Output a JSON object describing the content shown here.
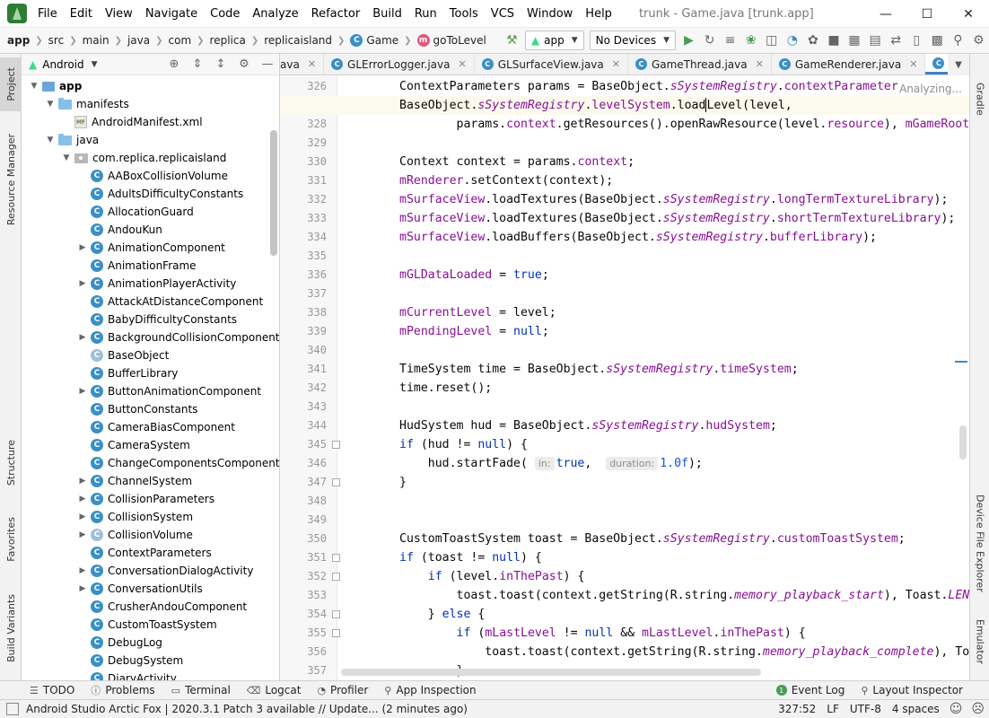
{
  "menubar": {
    "items": [
      "File",
      "Edit",
      "View",
      "Navigate",
      "Code",
      "Analyze",
      "Refactor",
      "Build",
      "Run",
      "Tools",
      "VCS",
      "Window",
      "Help"
    ],
    "window_title": "trunk - Game.java [trunk.app]"
  },
  "navbar": {
    "breadcrumbs": [
      "app",
      "src",
      "main",
      "java",
      "com",
      "replica",
      "replicaisland"
    ],
    "class_crumb": "Game",
    "method_crumb": "goToLevel",
    "run_config": "app",
    "device": "No Devices"
  },
  "left_tool_tabs": [
    "Project",
    "Resource Manager",
    "Structure",
    "Favorites",
    "Build Variants"
  ],
  "right_tool_tabs": [
    "Gradle",
    "Device File Explorer",
    "Emulator"
  ],
  "project_panel": {
    "view_mode": "Android",
    "tree": [
      {
        "label": "app",
        "type": "module",
        "depth": 0,
        "expanded": true,
        "bold": true
      },
      {
        "label": "manifests",
        "type": "folder",
        "depth": 1,
        "expanded": true
      },
      {
        "label": "AndroidManifest.xml",
        "type": "manifest",
        "depth": 2
      },
      {
        "label": "java",
        "type": "folder",
        "depth": 1,
        "expanded": true
      },
      {
        "label": "com.replica.replicaisland",
        "type": "package",
        "depth": 2,
        "expanded": true
      },
      {
        "label": "AABoxCollisionVolume",
        "type": "class",
        "depth": 3
      },
      {
        "label": "AdultsDifficultyConstants",
        "type": "class",
        "depth": 3
      },
      {
        "label": "AllocationGuard",
        "type": "class",
        "depth": 3
      },
      {
        "label": "AndouKun",
        "type": "class",
        "depth": 3
      },
      {
        "label": "AnimationComponent",
        "type": "class",
        "depth": 3,
        "expandable": true
      },
      {
        "label": "AnimationFrame",
        "type": "class",
        "depth": 3
      },
      {
        "label": "AnimationPlayerActivity",
        "type": "class",
        "depth": 3,
        "expandable": true
      },
      {
        "label": "AttackAtDistanceComponent",
        "type": "class",
        "depth": 3
      },
      {
        "label": "BabyDifficultyConstants",
        "type": "class",
        "depth": 3
      },
      {
        "label": "BackgroundCollisionComponent",
        "type": "class",
        "depth": 3,
        "expandable": true
      },
      {
        "label": "BaseObject",
        "type": "abstract",
        "depth": 3
      },
      {
        "label": "BufferLibrary",
        "type": "class",
        "depth": 3
      },
      {
        "label": "ButtonAnimationComponent",
        "type": "class",
        "depth": 3,
        "expandable": true
      },
      {
        "label": "ButtonConstants",
        "type": "class",
        "depth": 3
      },
      {
        "label": "CameraBiasComponent",
        "type": "class",
        "depth": 3
      },
      {
        "label": "CameraSystem",
        "type": "class",
        "depth": 3
      },
      {
        "label": "ChangeComponentsComponent",
        "type": "class",
        "depth": 3
      },
      {
        "label": "ChannelSystem",
        "type": "class",
        "depth": 3,
        "expandable": true
      },
      {
        "label": "CollisionParameters",
        "type": "class",
        "depth": 3,
        "expandable": true
      },
      {
        "label": "CollisionSystem",
        "type": "class",
        "depth": 3,
        "expandable": true
      },
      {
        "label": "CollisionVolume",
        "type": "abstract",
        "depth": 3,
        "expandable": true
      },
      {
        "label": "ContextParameters",
        "type": "class",
        "depth": 3
      },
      {
        "label": "ConversationDialogActivity",
        "type": "class",
        "depth": 3,
        "expandable": true
      },
      {
        "label": "ConversationUtils",
        "type": "class",
        "depth": 3,
        "expandable": true
      },
      {
        "label": "CrusherAndouComponent",
        "type": "class",
        "depth": 3
      },
      {
        "label": "CustomToastSystem",
        "type": "class",
        "depth": 3
      },
      {
        "label": "DebugLog",
        "type": "class",
        "depth": 3
      },
      {
        "label": "DebugSystem",
        "type": "class",
        "depth": 3
      },
      {
        "label": "DiaryActivity",
        "type": "class",
        "depth": 3
      }
    ]
  },
  "editor_tabs": [
    {
      "label": "ava",
      "partial": true
    },
    {
      "label": "GLErrorLogger.java"
    },
    {
      "label": "GLSurfaceView.java"
    },
    {
      "label": "GameThread.java"
    },
    {
      "label": "GameRenderer.java"
    },
    {
      "label": "Game.java",
      "active": true
    }
  ],
  "editor": {
    "analyzing_label": "Analyzing...",
    "current_line": "327",
    "lines": [
      {
        "n": "326",
        "html": "ContextParameters params = BaseObject.<span class='sf'>sSystemRegistry</span>.<span class='fld'>contextParameters</span>;"
      },
      {
        "n": "327",
        "html": "BaseObject.<span class='sf'>sSystemRegistry</span>.<span class='fld'>levelSystem</span>.load<span class='caret'></span>Level(level,"
      },
      {
        "n": "328",
        "html": "        params.<span class='fld'>context</span>.getResources().openRawResource(level.<span class='fld'>resource</span>), <span class='fld'>mGameRoot</span>);"
      },
      {
        "n": "329",
        "html": ""
      },
      {
        "n": "330",
        "html": "Context context = params.<span class='fld'>context</span>;"
      },
      {
        "n": "331",
        "html": "<span class='fld'>mRenderer</span>.setContext(context);"
      },
      {
        "n": "332",
        "html": "<span class='fld'>mSurfaceView</span>.loadTextures(BaseObject.<span class='sf'>sSystemRegistry</span>.<span class='fld'>longTermTextureLibrary</span>);"
      },
      {
        "n": "333",
        "html": "<span class='fld'>mSurfaceView</span>.loadTextures(BaseObject.<span class='sf'>sSystemRegistry</span>.<span class='fld'>shortTermTextureLibrary</span>);"
      },
      {
        "n": "334",
        "html": "<span class='fld'>mSurfaceView</span>.loadBuffers(BaseObject.<span class='sf'>sSystemRegistry</span>.<span class='fld'>bufferLibrary</span>);"
      },
      {
        "n": "335",
        "html": ""
      },
      {
        "n": "336",
        "html": "<span class='fld'>mGLDataLoaded</span> = <span class='kw'>true</span>;"
      },
      {
        "n": "337",
        "html": ""
      },
      {
        "n": "338",
        "html": "<span class='fld'>mCurrentLevel</span> = level;"
      },
      {
        "n": "339",
        "html": "<span class='fld'>mPendingLevel</span> = <span class='kw'>null</span>;"
      },
      {
        "n": "340",
        "html": ""
      },
      {
        "n": "341",
        "html": "TimeSystem time = BaseObject.<span class='sf'>sSystemRegistry</span>.<span class='fld'>timeSystem</span>;"
      },
      {
        "n": "342",
        "html": "time.reset();"
      },
      {
        "n": "343",
        "html": ""
      },
      {
        "n": "344",
        "html": "HudSystem hud = BaseObject.<span class='sf'>sSystemRegistry</span>.<span class='fld'>hudSystem</span>;"
      },
      {
        "n": "345",
        "html": "<span class='kw'>if</span> (hud != <span class='kw'>null</span>) {",
        "fold": true
      },
      {
        "n": "346",
        "html": "    hud.startFade( <span class='hint'>in:</span><span class='kw'>true</span>,  <span class='hint'>duration:</span><span class='num'>1.0f</span>);"
      },
      {
        "n": "347",
        "html": "}",
        "fold": true
      },
      {
        "n": "348",
        "html": ""
      },
      {
        "n": "349",
        "html": ""
      },
      {
        "n": "350",
        "html": "CustomToastSystem toast = BaseObject.<span class='sf'>sSystemRegistry</span>.<span class='fld'>customToastSystem</span>;"
      },
      {
        "n": "351",
        "html": "<span class='kw'>if</span> (toast != <span class='kw'>null</span>) {",
        "fold": true
      },
      {
        "n": "352",
        "html": "    <span class='kw'>if</span> (level.<span class='fld'>inThePast</span>) {",
        "fold": true
      },
      {
        "n": "353",
        "html": "        toast.toast(context.getString(R.string.<span class='sf'>memory_playback_start</span>), Toast.<span class='sf'>LENGTH_LONG</span>);"
      },
      {
        "n": "354",
        "html": "    } <span class='kw'>else</span> {",
        "fold": true
      },
      {
        "n": "355",
        "html": "        <span class='kw'>if</span> (<span class='fld'>mLastLevel</span> != <span class='kw'>null</span> &amp;&amp; <span class='fld'>mLastLevel</span>.<span class='fld'>inThePast</span>) {",
        "fold": true
      },
      {
        "n": "356",
        "html": "            toast.toast(context.getString(R.string.<span class='sf'>memory_playback_complete</span>), Toast.<span class='sf'>LENGTH_LONG</span>);"
      },
      {
        "n": "357",
        "html": "        }"
      }
    ]
  },
  "bottom_tabs": {
    "left": [
      "TODO",
      "Problems",
      "Terminal",
      "Logcat",
      "Profiler",
      "App Inspection"
    ],
    "right": [
      "Event Log",
      "Layout Inspector"
    ]
  },
  "status_bar": {
    "message": "Android Studio Arctic Fox | 2020.3.1 Patch 3 available // Update... (2 minutes ago)",
    "position": "327:52",
    "line_separator": "LF",
    "encoding": "UTF-8",
    "indent": "4 spaces"
  },
  "colors": {
    "keyword": "#0033b3",
    "field": "#871094",
    "number": "#1750eb",
    "active_tab_underline": "#4083c9",
    "class_icon": "#3a8fc6"
  }
}
